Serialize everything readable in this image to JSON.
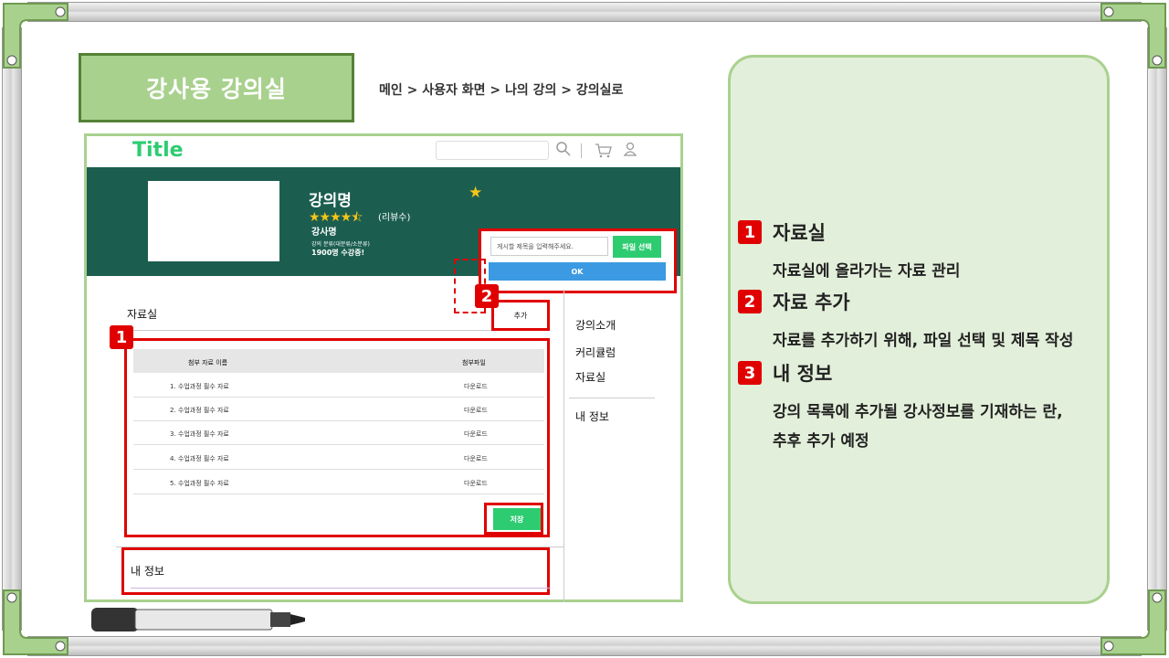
{
  "page": {
    "title": "강사용 강의실",
    "breadcrumb": "메인 > 사용자 화면 > 나의 강의 > 강의실로"
  },
  "mockup": {
    "logo": "Title",
    "course": {
      "name": "강의명",
      "stars": "★★★★⯪",
      "review_count": "(리뷰수)",
      "teacher": "강사명",
      "category": "강의 분류(대분류/소분류)",
      "students": "1900명 수강중!"
    },
    "upload": {
      "placeholder": "게시할 제목을 입력해주세요.",
      "file_button": "파일 선택",
      "ok_button": "OK"
    },
    "materials": {
      "section_title": "자료실",
      "add_button": "추가",
      "columns": [
        "첨부 자료 이름",
        "첨부파일"
      ],
      "rows": [
        {
          "name": "1. 수업과정 필수 자료",
          "file": "다운로드"
        },
        {
          "name": "2. 수업과정 필수 자료",
          "file": "다운로드"
        },
        {
          "name": "3. 수업과정 필수 자료",
          "file": "다운로드"
        },
        {
          "name": "4. 수업과정 필수 자료",
          "file": "다운로드"
        },
        {
          "name": "5. 수업과정 필수 자료",
          "file": "다운로드"
        }
      ],
      "save_button": "저장"
    },
    "sidebar": [
      "강의소개",
      "커리큘럼",
      "자료실",
      "내 정보"
    ],
    "my_info_title": "내 정보"
  },
  "markers": [
    "1",
    "2"
  ],
  "notes": [
    {
      "num": "1",
      "title": "자료실",
      "desc": [
        "자료실에 올라가는 자료 관리"
      ]
    },
    {
      "num": "2",
      "title": "자료 추가",
      "desc": [
        "자료를 추가하기 위해, 파일 선택 및 제목 작성"
      ]
    },
    {
      "num": "3",
      "title": "내 정보",
      "desc": [
        "강의 목록에 추가될 강사정보를 기재하는 란,",
        "추후 추가 예정"
      ]
    }
  ],
  "colors": {
    "title_fill": "#a9d18e",
    "title_border": "#548235",
    "notes_fill": "#e2efda",
    "hero_bg": "#1b5e50",
    "accent_green": "#2ecc71",
    "highlight_red": "#e00000",
    "ok_blue": "#3b9ae1"
  }
}
